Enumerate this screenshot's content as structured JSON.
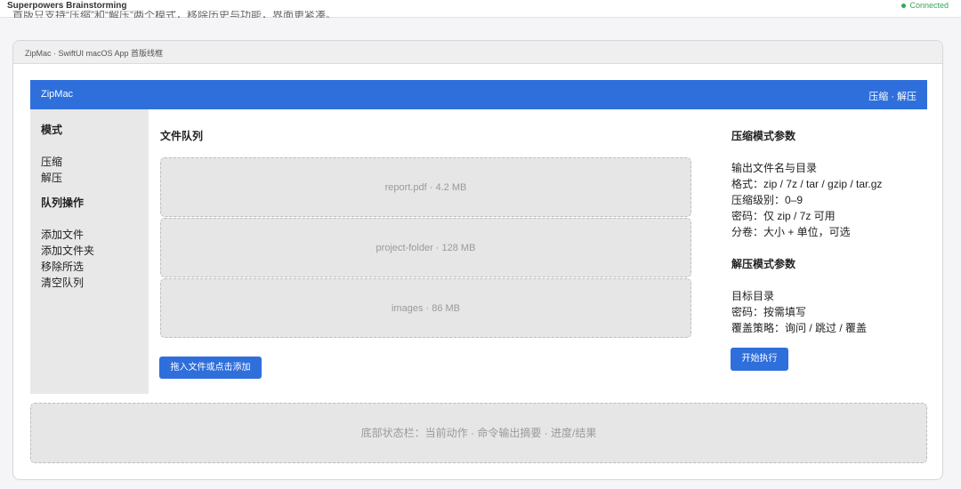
{
  "topbar": {
    "title": "Superpowers Brainstorming",
    "status": "Connected",
    "status_color": "#34a853"
  },
  "cut_text": "首版只支持“压缩”和“解压”两个模式，移除历史与功能，界面更紧凑。",
  "card": {
    "header": "ZipMac · SwiftUI macOS App 首版线框"
  },
  "app": {
    "title": "ZipMac",
    "header_right": "压缩 · 解压",
    "accent_color": "#2f6fdb"
  },
  "sidebar": {
    "mode_heading": "模式",
    "modes": [
      "压缩",
      "解压"
    ],
    "queue_heading": "队列操作",
    "queue_actions": [
      "添加文件",
      "添加文件夹",
      "移除所选",
      "清空队列"
    ]
  },
  "queue": {
    "title": "文件队列",
    "items": [
      "report.pdf · 4.2 MB",
      "project-folder · 128 MB",
      "images · 86 MB"
    ],
    "add_button": "拖入文件或点击添加"
  },
  "compress_params": {
    "heading": "压缩模式参数",
    "items": [
      "输出文件名与目录",
      "格式：zip / 7z / tar / gzip / tar.gz",
      "压缩级别：0–9",
      "密码：仅 zip / 7z 可用",
      "分卷：大小 + 单位，可选"
    ]
  },
  "extract_params": {
    "heading": "解压模式参数",
    "items": [
      "目标目录",
      "密码：按需填写",
      "覆盖策略：询问 / 跳过 / 覆盖"
    ]
  },
  "run_button": "开始执行",
  "statusbar": "底部状态栏：当前动作 · 命令输出摘要 · 进度/结果"
}
